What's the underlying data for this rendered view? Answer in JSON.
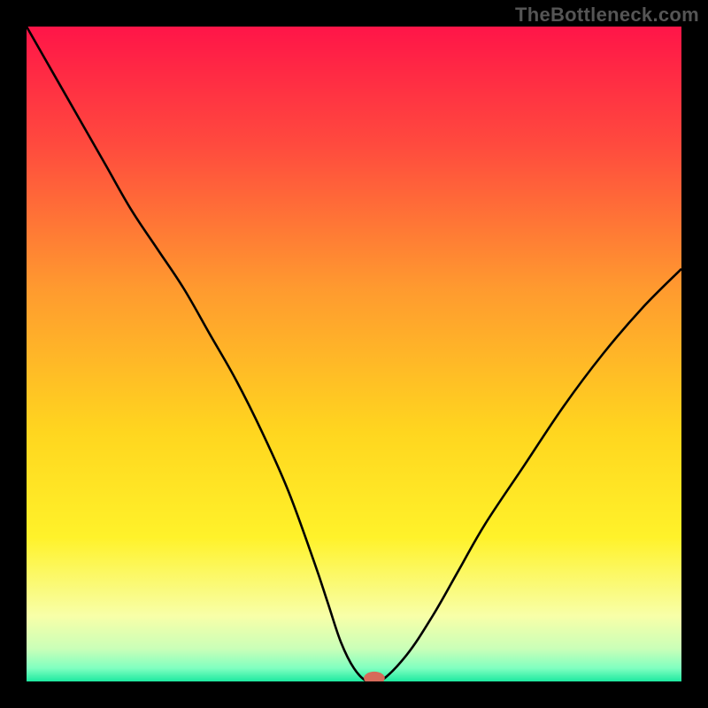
{
  "attribution": "TheBottleneck.com",
  "chart_data": {
    "type": "line",
    "title": "",
    "xlabel": "",
    "ylabel": "",
    "xlim": [
      0,
      100
    ],
    "ylim": [
      0,
      100
    ],
    "background_gradient": {
      "stops": [
        {
          "offset": 0.0,
          "color": "#ff1548"
        },
        {
          "offset": 0.18,
          "color": "#ff4a3e"
        },
        {
          "offset": 0.4,
          "color": "#ff9a2f"
        },
        {
          "offset": 0.62,
          "color": "#ffd61f"
        },
        {
          "offset": 0.78,
          "color": "#fff22a"
        },
        {
          "offset": 0.9,
          "color": "#f8ffa8"
        },
        {
          "offset": 0.95,
          "color": "#caffb8"
        },
        {
          "offset": 0.98,
          "color": "#7fffc0"
        },
        {
          "offset": 1.0,
          "color": "#1de9a0"
        }
      ]
    },
    "series": [
      {
        "name": "bottleneck-curve",
        "color": "#000000",
        "x": [
          0,
          4,
          8,
          12,
          16,
          20,
          24,
          28,
          32,
          36,
          40,
          44,
          46,
          48,
          50,
          52,
          54,
          58,
          62,
          66,
          70,
          76,
          82,
          88,
          94,
          100
        ],
        "y": [
          100,
          93,
          86,
          79,
          72,
          66,
          60,
          53,
          46,
          38,
          29,
          18,
          12,
          6,
          2,
          0,
          0,
          4,
          10,
          17,
          24,
          33,
          42,
          50,
          57,
          63
        ]
      }
    ],
    "marker": {
      "name": "optimal-point",
      "x": 53.1,
      "y": 0.5,
      "color": "#d66a5a",
      "rx": 1.6,
      "ry": 1.0
    }
  }
}
